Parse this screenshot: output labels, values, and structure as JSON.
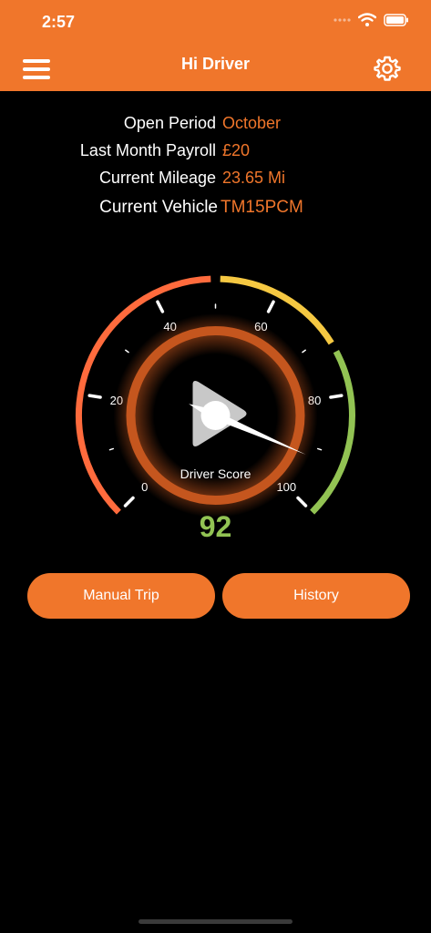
{
  "status": {
    "time": "2:57"
  },
  "header": {
    "title": "Hi Driver"
  },
  "info": [
    {
      "label": "Open Period",
      "value": "October"
    },
    {
      "label": "Last Month Payroll",
      "value": "£20"
    },
    {
      "label": "Current Mileage",
      "value": "23.65 Mi"
    },
    {
      "label": "Current Vehicle",
      "value": "TM15PCM"
    }
  ],
  "gauge": {
    "min": 0,
    "max": 100,
    "tick_labels": [
      "0",
      "20",
      "40",
      "60",
      "80",
      "100"
    ],
    "value": 92,
    "caption": "Driver Score",
    "display_value": "92",
    "colors": {
      "low": "#FF6B3D",
      "mid": "#F5C842",
      "high": "#92C353",
      "ring": "#C5561E",
      "needle": "#FFFFFF"
    }
  },
  "buttons": {
    "manual_trip": "Manual Trip",
    "history": "History"
  },
  "colors": {
    "accent": "#F0762B",
    "background": "#000000"
  }
}
